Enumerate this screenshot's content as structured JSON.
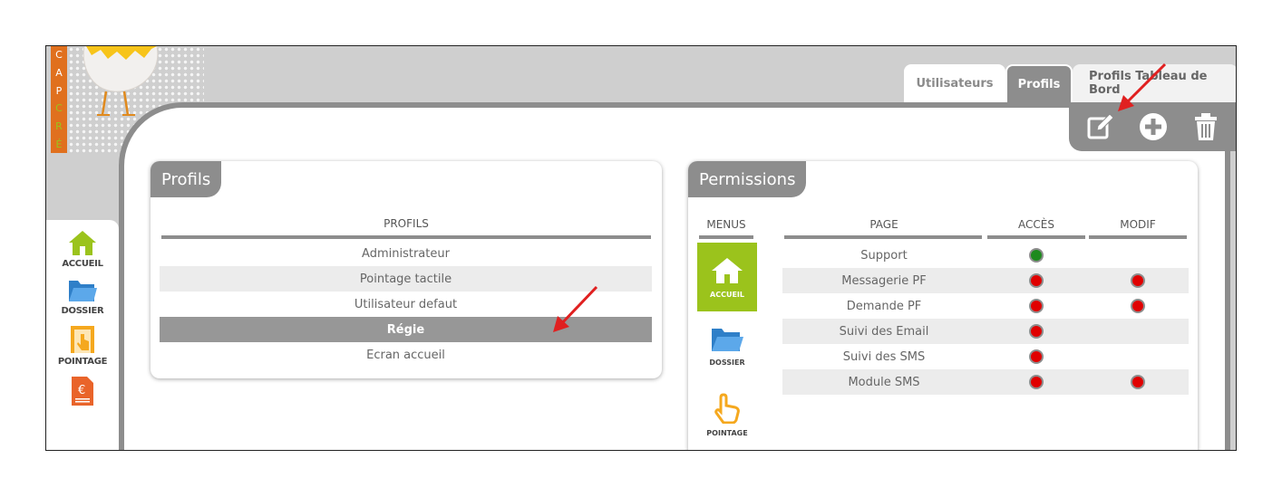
{
  "logo": {
    "letters": [
      "C",
      "A",
      "P",
      "C",
      "R",
      "É"
    ]
  },
  "tabs": [
    {
      "label": "Utilisateurs",
      "active": false
    },
    {
      "label": "Profils",
      "active": true
    },
    {
      "label": "Profils Tableau de Bord",
      "active": false
    }
  ],
  "toolbar": {
    "edit_icon": "edit-icon",
    "add_icon": "plus-circle-icon",
    "delete_icon": "trash-icon"
  },
  "sidebar": {
    "items": [
      {
        "label": "ACCUEIL",
        "icon": "home-icon"
      },
      {
        "label": "DOSSIER",
        "icon": "folder-icon"
      },
      {
        "label": "POINTAGE",
        "icon": "pointage-icon"
      },
      {
        "label": "",
        "icon": "invoice-euro-icon"
      }
    ]
  },
  "profils_panel": {
    "title": "Profils",
    "column_header": "PROFILS",
    "rows": [
      "Administrateur",
      "Pointage tactile",
      "Utilisateur defaut",
      "Régie",
      "Ecran accueil"
    ],
    "selected_index": 3
  },
  "permissions_panel": {
    "title": "Permissions",
    "menus_header": "MENUS",
    "menus": [
      {
        "label": "ACCUEIL",
        "active": true
      },
      {
        "label": "DOSSIER",
        "active": false
      },
      {
        "label": "POINTAGE",
        "active": false
      }
    ],
    "columns": {
      "page": "PAGE",
      "acces": "ACCÈS",
      "modif": "MODIF"
    },
    "rows": [
      {
        "page": "Support",
        "acces": "green",
        "modif": null
      },
      {
        "page": "Messagerie PF",
        "acces": "red",
        "modif": "red"
      },
      {
        "page": "Demande PF",
        "acces": "red",
        "modif": "red"
      },
      {
        "page": "Suivi des Email",
        "acces": "red",
        "modif": null
      },
      {
        "page": "Suivi des SMS",
        "acces": "red",
        "modif": null
      },
      {
        "page": "Module SMS",
        "acces": "red",
        "modif": "red"
      }
    ]
  },
  "colors": {
    "accent_green": "#9bc31c",
    "brand_orange": "#e0701e",
    "header_gray": "#8d8d8d",
    "status_green": "#1e8a1e",
    "status_red": "#e00000",
    "annotation_red": "#e02020"
  }
}
